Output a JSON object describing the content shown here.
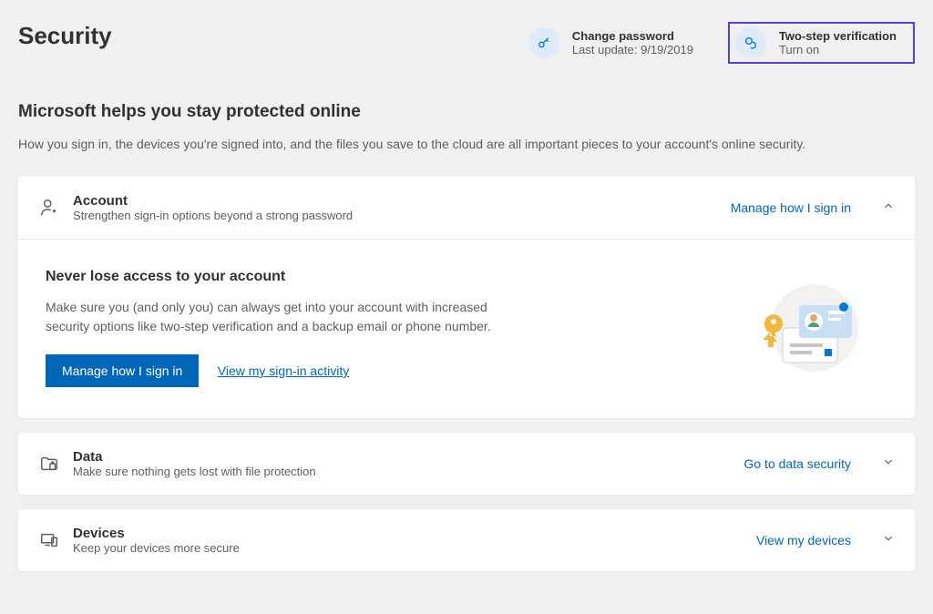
{
  "page": {
    "title": "Security"
  },
  "header_actions": {
    "change_password": {
      "title": "Change password",
      "subtitle": "Last update: 9/19/2019"
    },
    "two_step": {
      "title": "Two-step verification",
      "subtitle": "Turn on"
    }
  },
  "intro": {
    "title": "Microsoft helps you stay protected online",
    "desc": "How you sign in, the devices you're signed into, and the files you save to the cloud are all important pieces to your account's online security."
  },
  "account_card": {
    "title": "Account",
    "desc": "Strengthen sign-in options beyond a strong password",
    "link": "Manage how I sign in",
    "body": {
      "title": "Never lose access to your account",
      "desc": "Make sure you (and only you) can always get into your account with increased security options like two-step verification and a backup email or phone number.",
      "primary_button": "Manage how I sign in",
      "secondary_link": "View my sign-in activity"
    }
  },
  "data_card": {
    "title": "Data",
    "desc": "Make sure nothing gets lost with file protection",
    "link": "Go to data security"
  },
  "devices_card": {
    "title": "Devices",
    "desc": "Keep your devices more secure",
    "link": "View my devices"
  }
}
